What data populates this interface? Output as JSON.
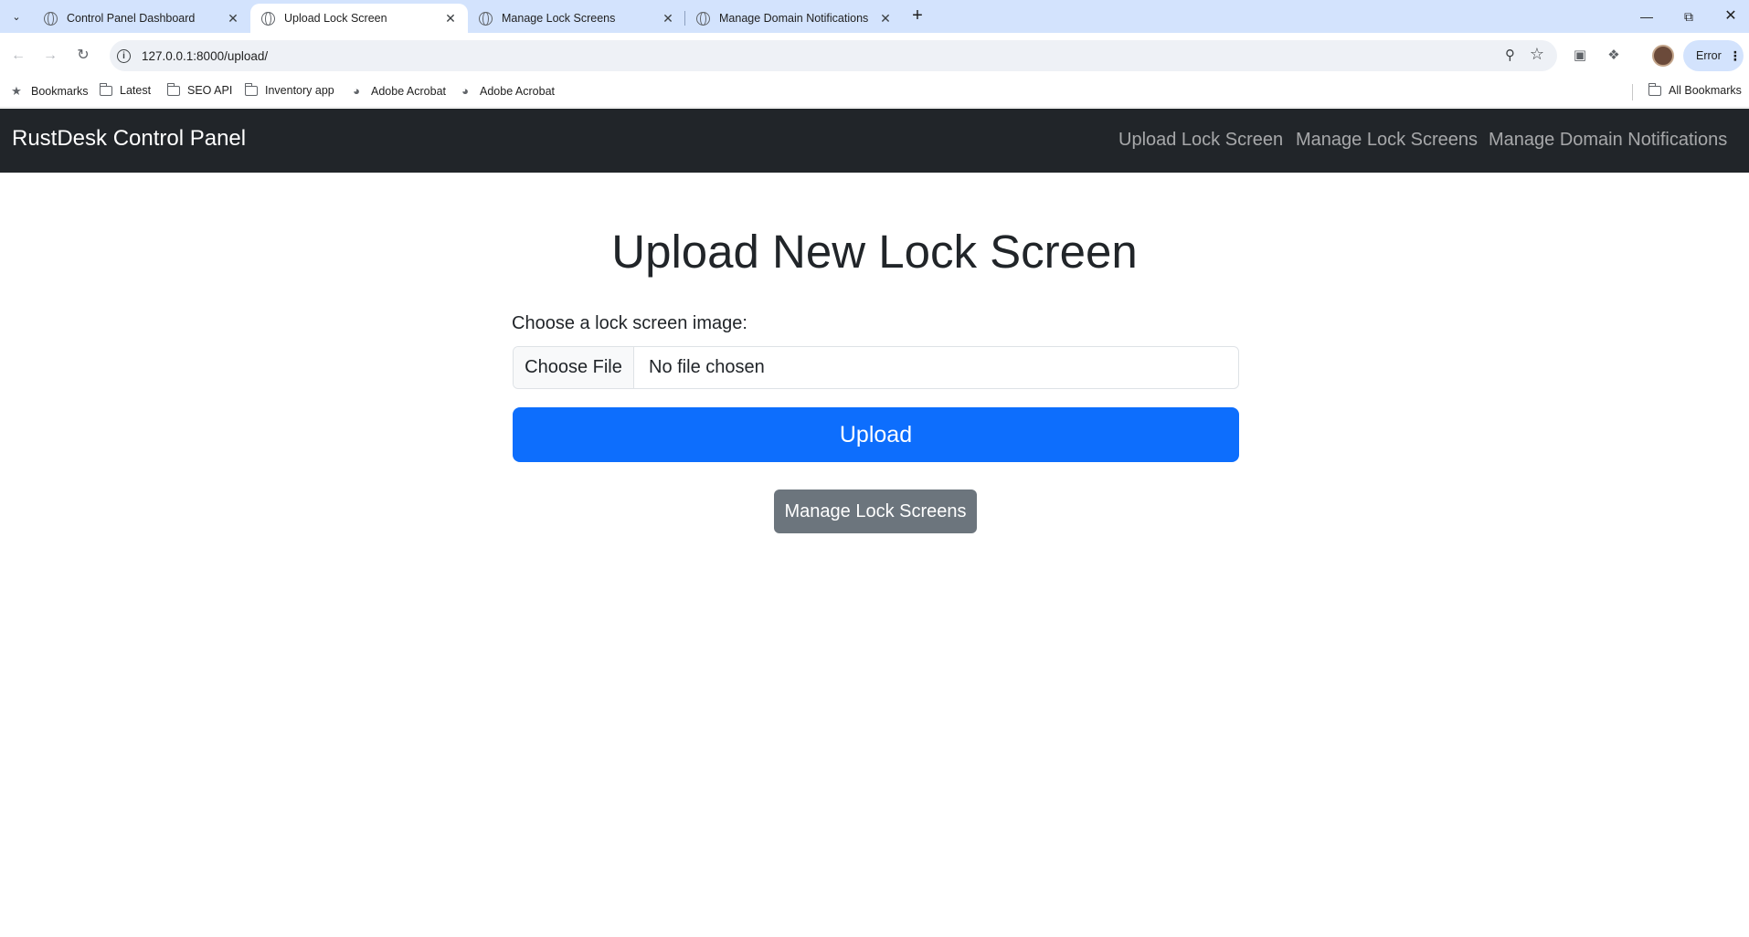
{
  "browser": {
    "tabs": [
      {
        "title": "Control Panel Dashboard",
        "active": false
      },
      {
        "title": "Upload Lock Screen",
        "active": true
      },
      {
        "title": "Manage Lock Screens",
        "active": false
      },
      {
        "title": "Manage Domain Notifications",
        "active": false
      }
    ],
    "url": "127.0.0.1:8000/upload/",
    "profile_status": "Error",
    "bookmarks": [
      {
        "label": "Bookmarks",
        "icon": "star-icon"
      },
      {
        "label": "Latest",
        "icon": "folder-icon"
      },
      {
        "label": "SEO API",
        "icon": "folder-icon"
      },
      {
        "label": "Inventory app",
        "icon": "folder-icon"
      },
      {
        "label": "Adobe Acrobat",
        "icon": "globe-icon"
      },
      {
        "label": "Adobe Acrobat",
        "icon": "globe-icon"
      }
    ],
    "all_bookmarks": "All Bookmarks"
  },
  "app": {
    "brand": "RustDesk Control Panel",
    "nav": [
      {
        "label": "Upload Lock Screen"
      },
      {
        "label": "Manage Lock Screens"
      },
      {
        "label": "Manage Domain Notifications"
      }
    ]
  },
  "page": {
    "title": "Upload New Lock Screen",
    "field_label": "Choose a lock screen image:",
    "file_button": "Choose File",
    "file_status": "No file chosen",
    "upload_button": "Upload",
    "manage_button": "Manage Lock Screens"
  },
  "colors": {
    "navbar_bg": "#212529",
    "primary": "#0d6efd",
    "secondary": "#6c757d",
    "tabstrip_bg": "#d3e3fd"
  }
}
